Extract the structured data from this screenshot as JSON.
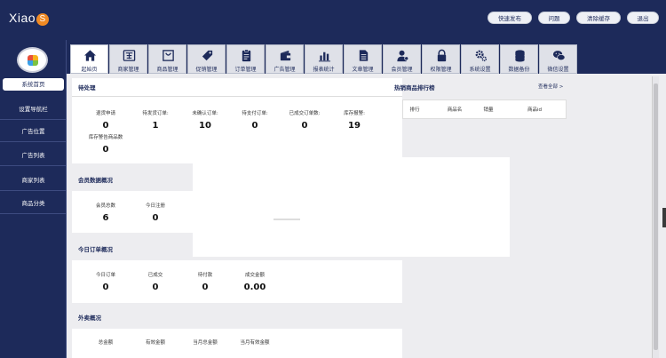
{
  "app": {
    "logo_text": "Xiao",
    "logo_badge": "S"
  },
  "top_buttons": [
    "快速发布",
    "问题",
    "清除缓存",
    "退出"
  ],
  "sidebar": {
    "items": [
      "系统首页",
      "设置导航栏",
      "广告位置",
      "广告列表",
      "商家列表",
      "商品分类"
    ]
  },
  "tabs": [
    {
      "label": "起始页",
      "icon": "home-icon"
    },
    {
      "label": "商家管理",
      "icon": "store-icon"
    },
    {
      "label": "商品管理",
      "icon": "bag-icon"
    },
    {
      "label": "促销管理",
      "icon": "tag-icon"
    },
    {
      "label": "订单管理",
      "icon": "clipboard-icon"
    },
    {
      "label": "广告管理",
      "icon": "wallet-icon"
    },
    {
      "label": "报表统计",
      "icon": "bar-chart-icon"
    },
    {
      "label": "文章管理",
      "icon": "document-icon"
    },
    {
      "label": "会员管理",
      "icon": "user-icon"
    },
    {
      "label": "权限管理",
      "icon": "lock-icon"
    },
    {
      "label": "系统设置",
      "icon": "gear-icon"
    },
    {
      "label": "数据备份",
      "icon": "database-icon"
    },
    {
      "label": "微信设置",
      "icon": "wechat-icon"
    }
  ],
  "pending": {
    "title": "待处理",
    "stats": [
      {
        "label": "退货申请",
        "value": "0"
      },
      {
        "label": "待发货订单:",
        "value": "1"
      },
      {
        "label": "未确认订单:",
        "value": "10"
      },
      {
        "label": "待支付订单:",
        "value": "0"
      },
      {
        "label": "已成交订单数:",
        "value": "0"
      },
      {
        "label": "库存报警:",
        "value": "19"
      },
      {
        "label": "库存警告商品数",
        "value": "0"
      }
    ]
  },
  "ranking": {
    "title": "热销商品排行榜",
    "view_all": "查看全部 >",
    "columns": [
      "排行",
      "商品名",
      "销量",
      "商品id"
    ]
  },
  "members": {
    "title": "会员数据概况",
    "stats": [
      {
        "label": "会员总数",
        "value": "6"
      },
      {
        "label": "今日注册",
        "value": "0"
      }
    ]
  },
  "today": {
    "title": "今日订单概况",
    "stats": [
      {
        "label": "今日订单",
        "value": "0"
      },
      {
        "label": "已成交",
        "value": "0"
      },
      {
        "label": "待付款",
        "value": "0"
      },
      {
        "label": "成交金额",
        "value": "0.00"
      }
    ]
  },
  "sales": {
    "title": "外卖概况",
    "stats": [
      {
        "label": "总金额"
      },
      {
        "label": "有效金额"
      },
      {
        "label": "当月总金额"
      },
      {
        "label": "当月有效金额"
      }
    ]
  },
  "colors": {
    "nav": "#1d2a5a",
    "accent": "#f08a24",
    "panel": "#ffffff"
  }
}
